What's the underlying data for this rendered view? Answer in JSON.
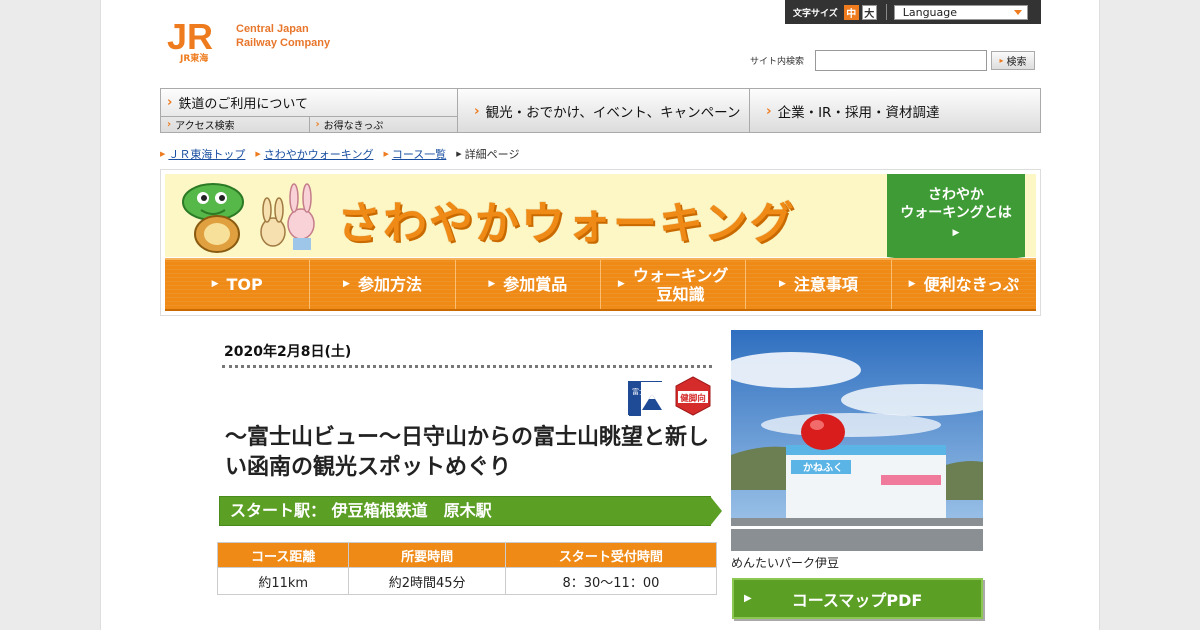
{
  "header": {
    "logo_mark": "JR",
    "logo_sub": "JR東海",
    "logo_line1": "Central Japan",
    "logo_line2": "Railway Company",
    "fontsize_label": "文字サイズ",
    "fontsize_mid": "中",
    "fontsize_big": "大",
    "language_label": "Language",
    "search_label": "サイト内検索",
    "search_value": "",
    "search_button": "検索"
  },
  "gnav": {
    "item1": "鉄道のご利用について",
    "sub1": "アクセス検索",
    "sub2": "お得なきっぷ",
    "item2": "観光・おでかけ、イベント、キャンペーン",
    "item3": "企業・IR・採用・資材調達"
  },
  "breadcrumb": {
    "b1": "ＪＲ東海トップ",
    "b2": "さわやかウォーキング",
    "b3": "コース一覧",
    "current": "詳細ページ"
  },
  "banner": {
    "title": "さわやかウォーキング",
    "about_line1": "さわやか",
    "about_line2": "ウォーキングとは",
    "nav": [
      "TOP",
      "参加方法",
      "参加賞品",
      "ウォーキング",
      "豆知識",
      "注意事項",
      "便利なきっぷ"
    ]
  },
  "event": {
    "date": "2020年2月8日(土)",
    "badge_fuji": "富士山ビュー",
    "badge_ken": "健脚向",
    "title": "～富士山ビュー～日守山からの富士山眺望と新しい函南の観光スポットめぐり",
    "start": "スタート駅：  伊豆箱根鉄道　原木駅",
    "table_headers": [
      "コース距離",
      "所要時間",
      "スタート受付時間"
    ],
    "table_values": [
      "約11km",
      "約2時間45分",
      "8：30～11：00"
    ],
    "photo_sign": "かねふく",
    "photo_caption": "めんたいパーク伊豆",
    "pdf_button": "コースマップPDF"
  },
  "colors": {
    "orange": "#ee8a15",
    "green": "#5b9f25",
    "jr_orange": "#ee7c1f"
  }
}
